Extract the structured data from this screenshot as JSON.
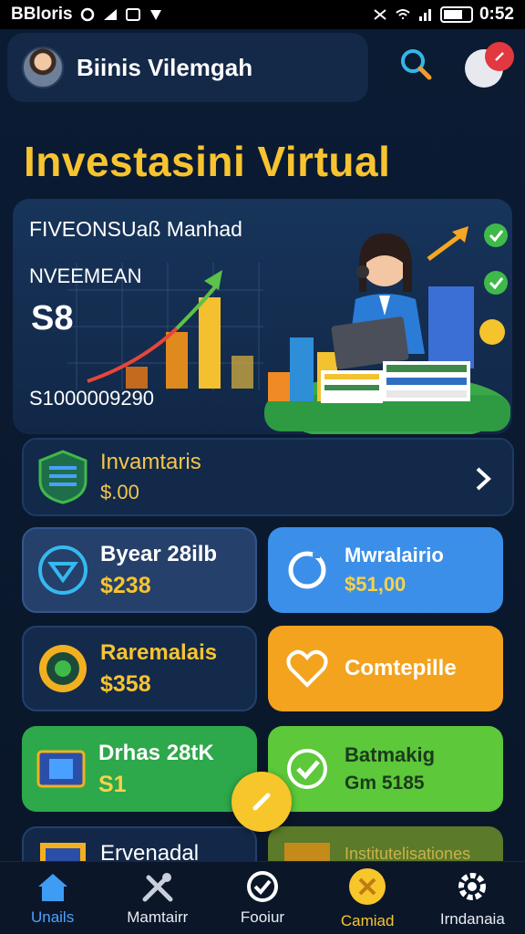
{
  "status_bar": {
    "carrier": "BBloris",
    "time": "0:52"
  },
  "header": {
    "title": "Biinis Vilemgah"
  },
  "page_title": "Investasini Virtual",
  "hero": {
    "title": "FIVEONSUaß Manhad",
    "subtitle": "NVEEMEAN",
    "value": "S8",
    "amount": "S1000009290"
  },
  "featured": {
    "label": "Invamtaris",
    "value": "$.00"
  },
  "cards": [
    {
      "label": "Byear 28ilb",
      "value": "$238",
      "icon": "triangle-badge-icon"
    },
    {
      "label": "Mwralairio",
      "value": "$51,00",
      "icon": "circle-icon"
    },
    {
      "label": "Raremalais",
      "value": "$358",
      "icon": "gear-chip-icon"
    },
    {
      "label": "Comtepille",
      "value": "",
      "icon": "heart-icon"
    },
    {
      "label": "Drhas 28tK",
      "value": "S1",
      "icon": "chip-icon"
    },
    {
      "label": "Batmakig",
      "value": "Gm 5185",
      "icon": "check-icon"
    },
    {
      "label": "Ervenadal",
      "value": "",
      "icon": "folder-icon"
    },
    {
      "label": "Institutelisationes",
      "value": "",
      "icon": "folder-icon"
    }
  ],
  "bottom_nav": [
    {
      "label": "Unails",
      "icon": "home-icon"
    },
    {
      "label": "Mamtairr",
      "icon": "tools-icon"
    },
    {
      "label": "Fooiur",
      "icon": "check-circle-icon"
    },
    {
      "label": "Camiad",
      "icon": "coin-icon"
    },
    {
      "label": "Irndanaia",
      "icon": "gear-icon"
    }
  ],
  "colors": {
    "accent_yellow": "#f7c430",
    "accent_blue": "#3c8fe8",
    "accent_orange": "#f4a31e",
    "accent_green": "#2da84a",
    "background": "#0a1b33"
  }
}
